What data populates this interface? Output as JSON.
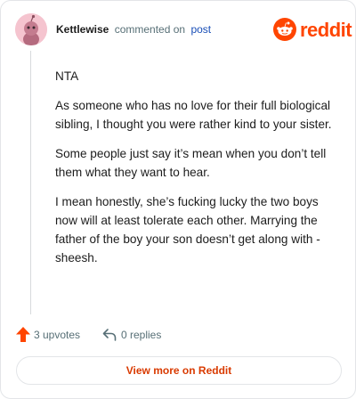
{
  "header": {
    "username": "Kettlewise",
    "action_text": "commented on",
    "post_link": "post",
    "brand_name": "reddit"
  },
  "comment": {
    "paragraphs": [
      "NTA",
      "As someone who has no love for their full biological sibling, I thought you were rather kind to your sister.",
      "Some people just say it’s mean when you don’t tell them what they want to hear.",
      "I mean honestly, she’s fucking lucky the two boys now will at least tolerate each other. Marrying the father of the boy your son doesn’t get along with - sheesh."
    ]
  },
  "actions": {
    "upvotes_label": "3 upvotes",
    "replies_label": "0 replies"
  },
  "footer": {
    "view_more_label": "View more on Reddit"
  },
  "colors": {
    "brand_orange": "#ff4500",
    "upvote_orange": "#ff4500",
    "link_blue": "#1a4fb7",
    "view_more_text": "#d93a00",
    "avatar_bg": "#f5c4cf"
  },
  "icons": {
    "avatar": "snoo-avatar-icon",
    "brand": "reddit-snoo-icon",
    "upvote": "upvote-arrow-icon",
    "reply": "reply-arrow-icon"
  }
}
